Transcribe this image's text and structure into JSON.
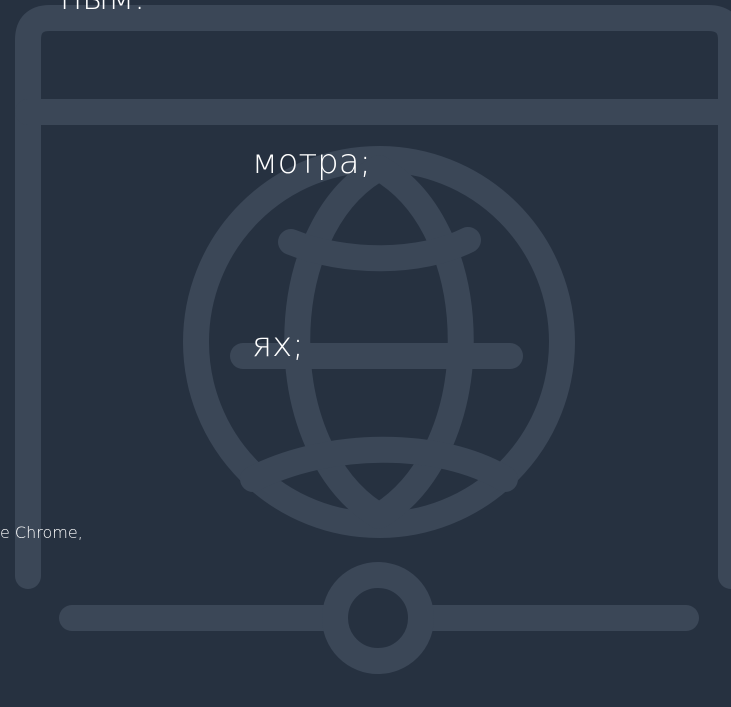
{
  "text_fragments": {
    "line1": "ным:",
    "line2": "мотра;",
    "line3": "ях;",
    "line4": "e Chrome,"
  },
  "colors": {
    "background": "#263140",
    "illustration_stroke": "#3b4757",
    "text": "#ffffff"
  },
  "icons": {
    "illustration": "browser-globe-network-icon"
  }
}
